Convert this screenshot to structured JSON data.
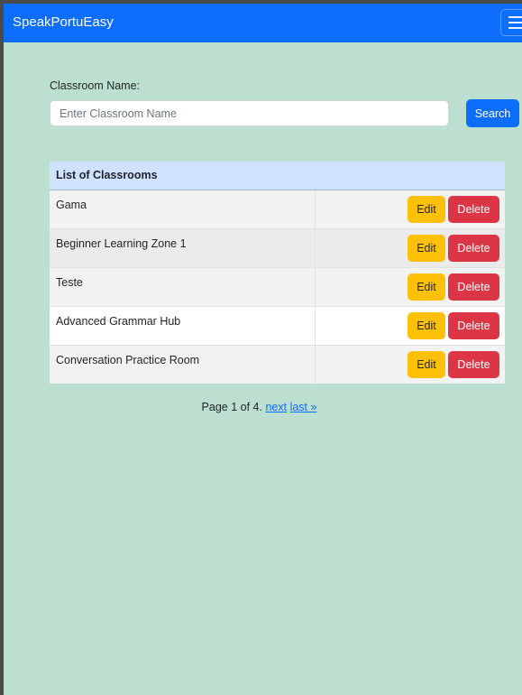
{
  "navbar": {
    "brand": "SpeakPortuEasy",
    "menu_icon": "hamburger-icon"
  },
  "search": {
    "label": "Classroom Name:",
    "placeholder": "Enter Classroom Name",
    "value": "",
    "button_label": "Search"
  },
  "table": {
    "header": "List of Classrooms",
    "edit_label": "Edit",
    "delete_label": "Delete",
    "rows": [
      {
        "name": "Gama"
      },
      {
        "name": "Beginner Learning Zone 1"
      },
      {
        "name": "Teste"
      },
      {
        "name": "Advanced Grammar Hub"
      },
      {
        "name": "Conversation Practice Room"
      }
    ]
  },
  "pagination": {
    "status": "Page 1 of 4.",
    "next_label": "next",
    "last_label": "last »"
  },
  "colors": {
    "navbar": "#0d6efd",
    "background": "#bddfcf",
    "edit": "#ffc107",
    "delete": "#dc3545",
    "table_header": "#cfe2ff"
  }
}
